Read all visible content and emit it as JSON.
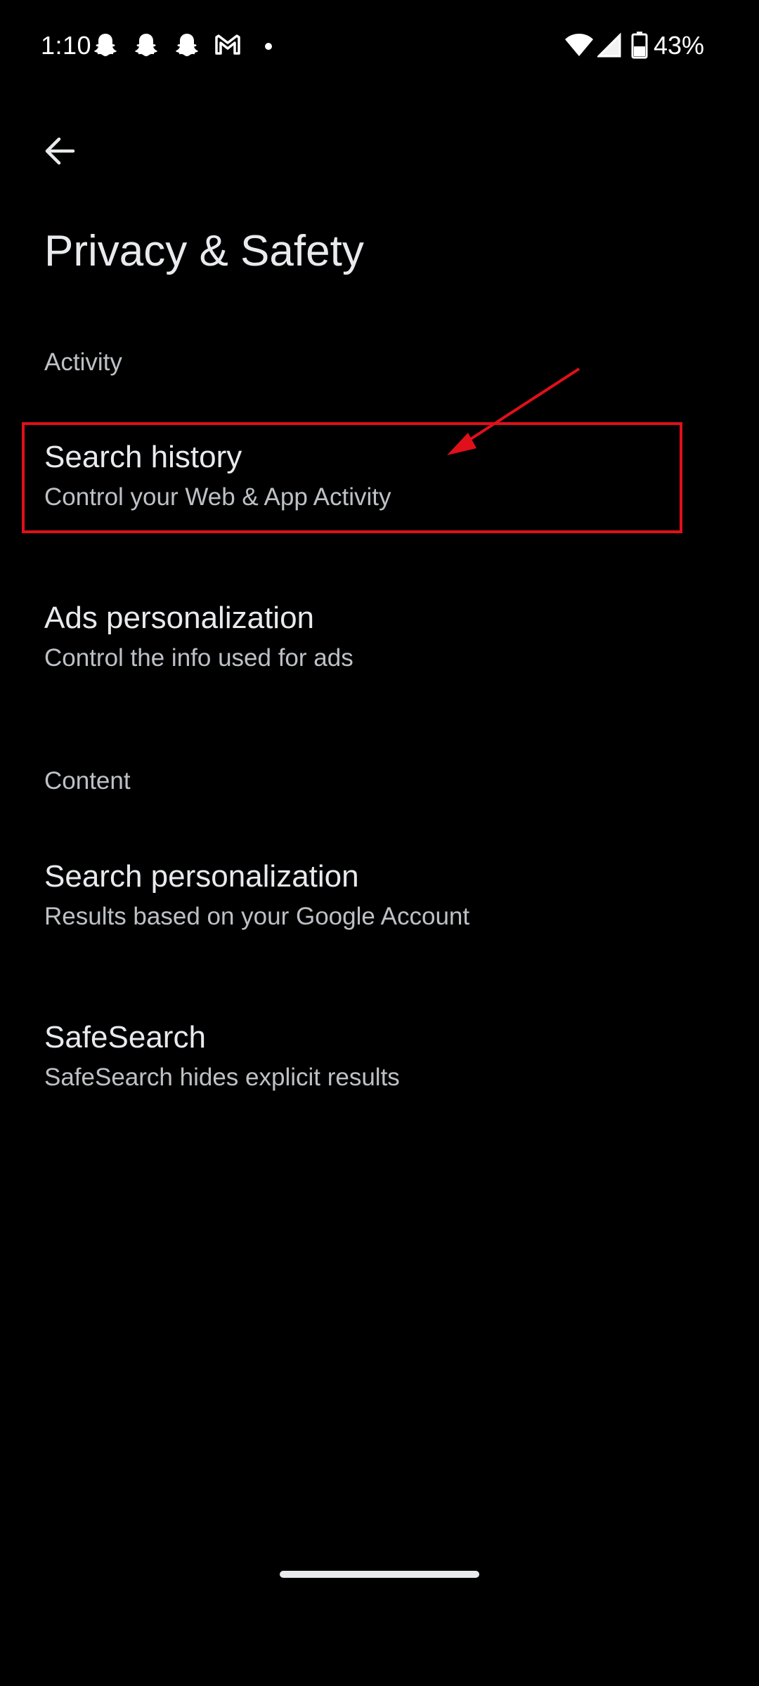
{
  "status_bar": {
    "time": "1:10",
    "battery": "43%",
    "notification_icons": [
      "snapchat-icon",
      "snapchat-icon",
      "snapchat-icon",
      "gmail-icon"
    ]
  },
  "page": {
    "title": "Privacy & Safety"
  },
  "sections": [
    {
      "header": "Activity",
      "items": [
        {
          "title": "Search history",
          "subtitle": "Control your Web & App Activity"
        },
        {
          "title": "Ads personalization",
          "subtitle": "Control the info used for ads"
        }
      ]
    },
    {
      "header": "Content",
      "items": [
        {
          "title": "Search personalization",
          "subtitle": "Results based on your Google Account"
        },
        {
          "title": "SafeSearch",
          "subtitle": "SafeSearch hides explicit results"
        }
      ]
    }
  ],
  "colors": {
    "background": "#000000",
    "primary_text": "#e8eaed",
    "secondary_text": "#bdc1c6",
    "annotation": "#e0101a"
  }
}
